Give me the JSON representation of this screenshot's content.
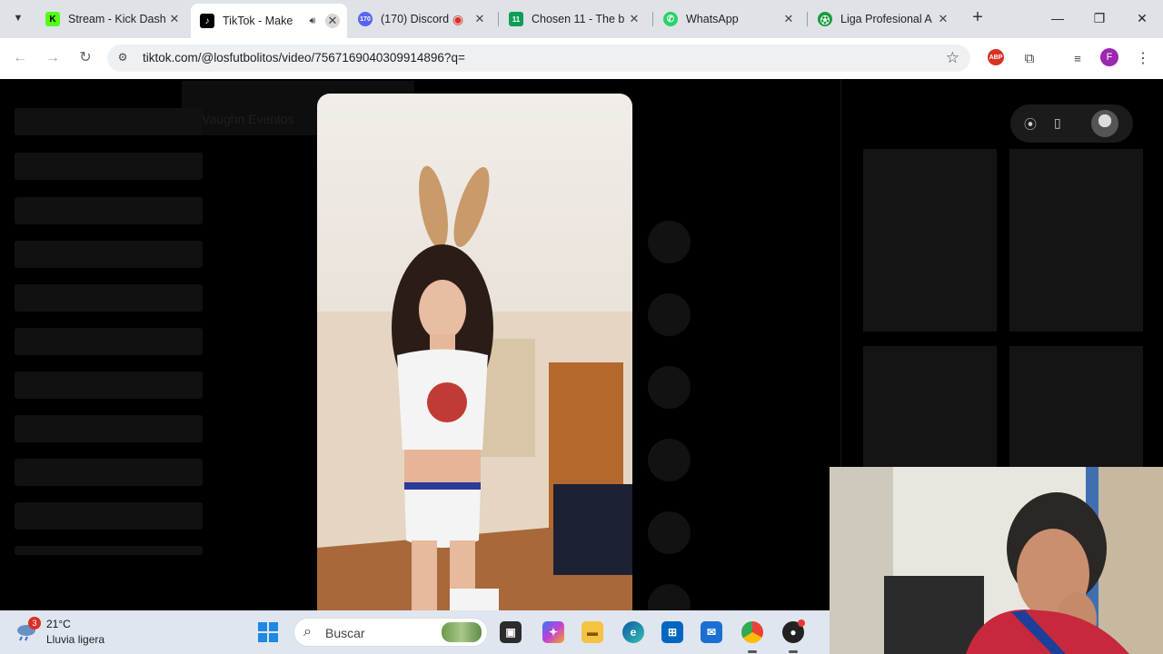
{
  "browser": {
    "tabs": [
      {
        "title": "Stream - Kick Dash",
        "favicon": "kick-icon",
        "color": "#53fc18"
      },
      {
        "title": "TikTok - Make",
        "favicon": "tiktok-icon",
        "color": "#000000",
        "active": true
      },
      {
        "title": "(170) Discord",
        "favicon": "discord-icon",
        "color": "#5865f2",
        "badge": "170"
      },
      {
        "title": "Chosen 11 - The b",
        "favicon": "chosen11-icon",
        "color": "#0f9d58",
        "badge": "11"
      },
      {
        "title": "WhatsApp",
        "favicon": "whatsapp-icon",
        "color": "#25d366"
      },
      {
        "title": "Liga Profesional A",
        "favicon": "liga-icon",
        "color": "#1a9c3e"
      }
    ],
    "url": "tiktok.com/@losfutbolitos/video/7567169040309914896?q=",
    "profile_initial": "F",
    "adblock_label": "ABP"
  },
  "page": {
    "ghost_text": "Vaughn Eventos"
  },
  "taskbar": {
    "weather_badge": "3",
    "temperature": "21°C",
    "condition": "Lluvia ligera",
    "search_placeholder": "Buscar"
  }
}
